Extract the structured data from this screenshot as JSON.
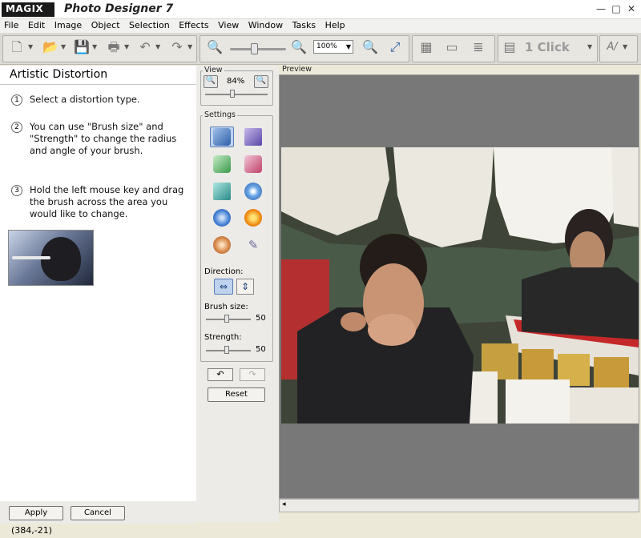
{
  "window": {
    "logo": "MAGIX",
    "title": "Photo Designer 7",
    "minimize": "—",
    "maximize": "□",
    "close": "✕"
  },
  "menu": [
    "File",
    "Edit",
    "Image",
    "Object",
    "Selection",
    "Effects",
    "View",
    "Window",
    "Tasks",
    "Help"
  ],
  "toolbar": {
    "zoom_value": "100%",
    "one_click": "1 Click",
    "icons": [
      "new-icon",
      "open-icon",
      "save-icon",
      "print-icon",
      "undo-icon",
      "redo-icon",
      "zoom-out-icon",
      "zoom-in-icon",
      "zoom-100-icon",
      "zoom-fit-icon",
      "compare-icon",
      "screen-icon",
      "layers-icon",
      "one-click-icon",
      "auto-icon"
    ]
  },
  "left_panel": {
    "title": "Artistic Distortion",
    "steps": [
      {
        "num": "1",
        "text": "Select a distortion type."
      },
      {
        "num": "2",
        "text": "You can use \"Brush size\" and \"Strength\" to change the radius and angle of your brush."
      },
      {
        "num": "3",
        "text": "Hold the left mouse key and drag the brush across the area you would like to change."
      }
    ],
    "apply_label": "Apply",
    "cancel_label": "Cancel"
  },
  "settings_panel": {
    "view_label": "View",
    "view_zoom": "84%",
    "settings_label": "Settings",
    "direction_label": "Direction:",
    "brush_size_label": "Brush size:",
    "brush_size_value": "50",
    "strength_label": "Strength:",
    "strength_value": "50",
    "reset_label": "Reset"
  },
  "preview": {
    "label": "Preview"
  },
  "status": {
    "coords": "(384,-21)"
  },
  "colors": {
    "preview_bg": "#787878",
    "panel_bg": "#ecebe8",
    "selection": "#bfd2ee"
  }
}
